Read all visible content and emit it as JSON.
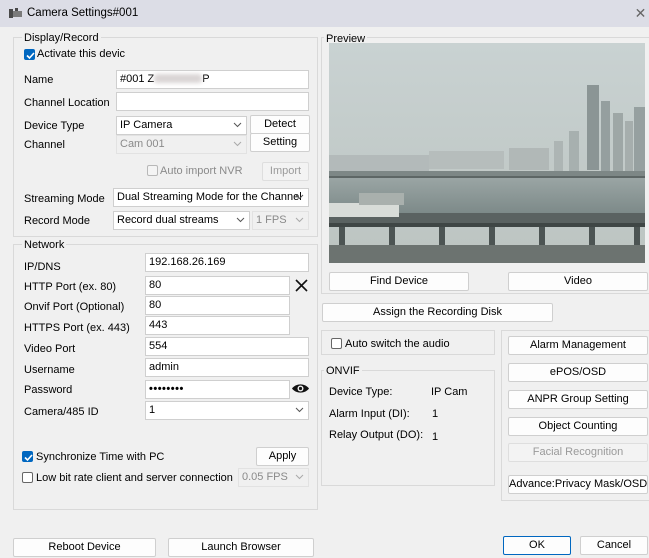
{
  "window": {
    "title": "Camera Settings#001",
    "close_glyph": "✕"
  },
  "display_record": {
    "group_title": "Display/Record",
    "activate": {
      "label": "Activate this devic",
      "checked": true
    },
    "name": {
      "label": "Name",
      "value_prefix": "#001 Z",
      "value_suffix": "P"
    },
    "channel_location": {
      "label": "Channel Location",
      "value": ""
    },
    "device_type": {
      "label": "Device Type",
      "value": "IP Camera",
      "button": "Detect"
    },
    "channel": {
      "label": "Channel",
      "value": "Cam 001",
      "button": "Setting"
    },
    "auto_import": {
      "label": "Auto import NVR",
      "button": "Import",
      "checked": false
    },
    "streaming_mode": {
      "label": "Streaming Mode",
      "value": "Dual Streaming Mode for the Channel"
    },
    "record_mode": {
      "label": "Record Mode",
      "value": "Record dual streams",
      "fps": "1 FPS"
    }
  },
  "network": {
    "group_title": "Network",
    "ip_dns": {
      "label": "IP/DNS",
      "value": "192.168.26.169"
    },
    "http_port": {
      "label": "HTTP Port (ex. 80)",
      "value": "80"
    },
    "onvif_port": {
      "label": "Onvif Port (Optional)",
      "value": "80"
    },
    "https_port": {
      "label": "HTTPS Port (ex. 443)",
      "value": "443"
    },
    "video_port": {
      "label": "Video Port",
      "value": "554"
    },
    "username": {
      "label": "Username",
      "value": "admin"
    },
    "password": {
      "label": "Password",
      "value": "••••••••"
    },
    "camera_id": {
      "label": "Camera/485 ID",
      "value": "1"
    },
    "sync_time": {
      "label": "Synchronize Time with PC",
      "checked": true,
      "button": "Apply"
    },
    "low_bitrate": {
      "label": "Low bit rate client and server connection",
      "checked": false,
      "fps": "0.05 FPS"
    }
  },
  "preview": {
    "group_title": "Preview",
    "find_device": "Find Device",
    "video": "Video",
    "assign_disk": "Assign the Recording Disk"
  },
  "audio": {
    "label": "Auto switch the audio",
    "checked": false
  },
  "onvif": {
    "group_title": "ONVIF",
    "device_type_label": "Device Type:",
    "device_type_value": "IP Cam",
    "alarm_input_label": "Alarm Input (DI):",
    "alarm_input_value": "1",
    "relay_output_label": "Relay Output (DO):",
    "relay_output_value": "1"
  },
  "side_buttons": {
    "alarm_management": "Alarm Management",
    "epos_osd": "ePOS/OSD",
    "anpr": "ANPR Group Setting",
    "object_counting": "Object Counting",
    "facial_recognition": "Facial Recognition",
    "privacy_mask": "Advance:Privacy Mask/OSD"
  },
  "footer": {
    "reboot": "Reboot Device",
    "launch_browser": "Launch Browser",
    "ok": "OK",
    "cancel": "Cancel"
  },
  "colors": {
    "accent": "#0067c0",
    "titlebar": "#dcdde6",
    "window_bg": "#f0f0f0",
    "preview_sky": "#c6cfcf"
  }
}
